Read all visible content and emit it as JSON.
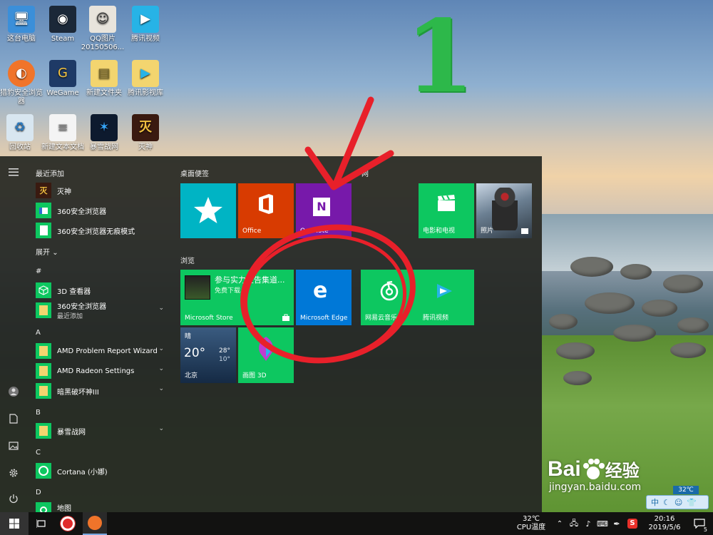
{
  "desktop": {
    "icons": [
      {
        "label": "这台电脑",
        "glyph": "🖥"
      },
      {
        "label": "Steam",
        "glyph": "◉"
      },
      {
        "label": "QQ图片20150506...",
        "glyph": "☺"
      },
      {
        "label": "腾讯视频",
        "glyph": "▶"
      },
      {
        "label": "猎豹安全浏览器",
        "glyph": "◐"
      },
      {
        "label": "WeGame",
        "glyph": "G"
      },
      {
        "label": "新建文件夹",
        "glyph": "▤"
      },
      {
        "label": "腾讯影视库",
        "glyph": "▶"
      },
      {
        "label": "回收站",
        "glyph": "♻"
      },
      {
        "label": "新建文本文档",
        "glyph": "≡"
      },
      {
        "label": "暴雪战网",
        "glyph": "✶"
      },
      {
        "label": "灭神",
        "glyph": "灭"
      }
    ],
    "annotation_number": "1"
  },
  "start_menu": {
    "recent_header": "最近添加",
    "recent": [
      {
        "name": "灭神"
      },
      {
        "name": "360安全浏览器"
      },
      {
        "name": "360安全浏览器无痕模式"
      }
    ],
    "expand": "展开",
    "sections": [
      {
        "letter": "#",
        "apps": [
          {
            "name": "3D 查看器",
            "sub": ""
          },
          {
            "name": "360安全浏览器",
            "sub": "最近添加"
          }
        ]
      },
      {
        "letter": "A",
        "apps": [
          {
            "name": "AMD Problem Report Wizard",
            "sub": ""
          },
          {
            "name": "AMD Radeon Settings",
            "sub": ""
          },
          {
            "name": "暗黑破坏神III",
            "sub": ""
          }
        ]
      },
      {
        "letter": "B",
        "apps": [
          {
            "name": "暴雪战网",
            "sub": ""
          }
        ]
      },
      {
        "letter": "C",
        "apps": [
          {
            "name": "Cortana (小娜)",
            "sub": ""
          }
        ]
      },
      {
        "letter": "D",
        "apps": [
          {
            "name": "地图",
            "sub": ""
          }
        ]
      }
    ],
    "groups": {
      "desktop_bookmarks": "桌面便签",
      "browse": "浏览",
      "partial_third": "网"
    },
    "tiles": {
      "office": "Office",
      "onenote": "OneNote",
      "movies": "电影和电视",
      "photos": "照片",
      "store": "Microsoft Store",
      "store_promo_title": "参与实力宣告集道...",
      "store_promo_sub": "免费下载",
      "edge": "Microsoft Edge",
      "netease": "网易云音乐",
      "tencent_video": "腾讯视频",
      "weather_condition": "晴",
      "weather_temp": "20°",
      "weather_high": "28°",
      "weather_low": "10°",
      "weather_city": "北京",
      "paint3d": "画图 3D"
    }
  },
  "taskbar": {
    "cpu_temp": "32℃",
    "cpu_label": "CPU温度",
    "time": "20:16",
    "date": "2019/5/6",
    "notification_count": "5",
    "ime": "中",
    "float_temp": "32℃"
  },
  "watermark": {
    "brand": "Bai",
    "brand_cn": "经验",
    "url": "jingyan.baidu.com"
  },
  "colors": {
    "tile_green": "#0dc760",
    "tile_teal": "#00b4c4",
    "tile_office": "#d83b01",
    "tile_onenote": "#7719aa",
    "tile_edge": "#0078d7",
    "annotation_red": "#e8202a",
    "annotation_green": "#2db84a"
  }
}
